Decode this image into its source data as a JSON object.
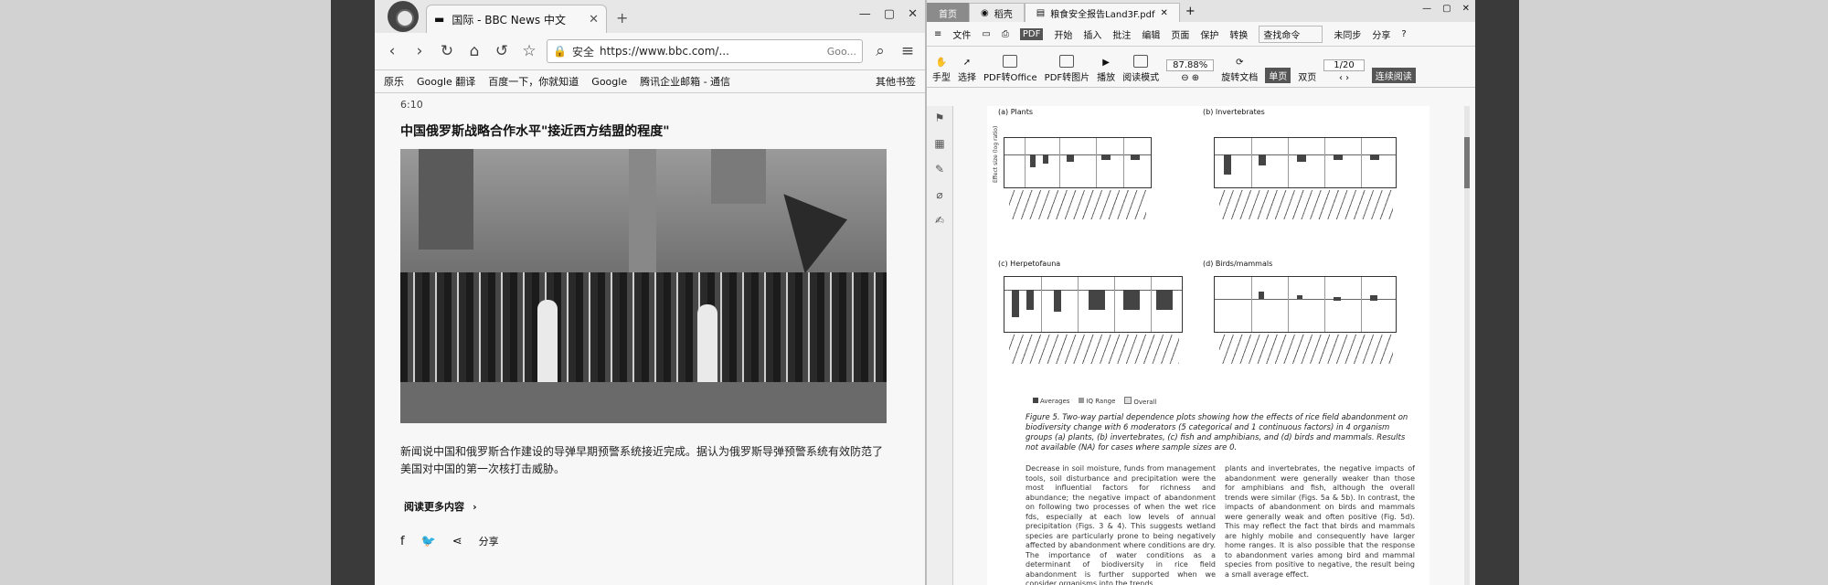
{
  "browser": {
    "tab_title": "国际 - BBC News 中文",
    "tab_icon": "bbc-icon",
    "window_controls": [
      "—",
      "▢",
      "✕"
    ],
    "address_secure": "安全",
    "address_url": "https://www.bbc.com/...",
    "address_search_placeholder": "Goo...",
    "bookmarks": [
      "原乐",
      "Google 翻译",
      "百度一下，你就知道",
      "Google",
      "腾讯企业邮箱 - 通信"
    ],
    "bookmarks_more": "其他书签"
  },
  "article": {
    "time": "6:10",
    "headline": "中国俄罗斯战略合作水平\"接近西方结盟的程度\"",
    "body": "新闻说中国和俄罗斯合作建设的导弹早期预警系统接近完成。据认为俄罗斯导弹预警系统有效防范了美国对中国的第一次核打击威胁。",
    "read_more": "阅读更多内容",
    "share_count": "分享"
  },
  "pdf_app": {
    "home_tab": "首页",
    "tab_1": "稻壳",
    "tab_2": "粮食安全报告Land3F.pdf",
    "window_controls": [
      "—",
      "▢",
      "✕"
    ],
    "menu": [
      "文件",
      "开始",
      "插入",
      "批注",
      "编辑",
      "页面",
      "保护",
      "转换"
    ],
    "menu_tag": "PDF",
    "find": "查找命令",
    "menu_right": [
      "未同步",
      "分享",
      "?"
    ],
    "ribbon": [
      "手型",
      "选择",
      "PDF转Office",
      "PDF转图片",
      "播放",
      "阅读模式",
      "旋转文档",
      "单页",
      "双页",
      "连续阅读"
    ],
    "zoom": "87.88%",
    "page": "1/20"
  },
  "pdf_page": {
    "fig_a": "(a) Plants",
    "fig_b": "(b) Invertebrates",
    "fig_c": "(c) Herpetofauna",
    "fig_d": "(d) Birds/mammals",
    "y_axis": "Effect size (log ratio)",
    "legend": [
      "Averages",
      "IQ Range",
      "Overall"
    ],
    "caption": "Figure 5. Two-way partial dependence plots showing how the effects of rice field abandonment on biodiversity change with 6 moderators (5 categorical and 1 continuous factors) in 4 organism groups (a) plants, (b) invertebrates, (c) fish and amphibians, and (d) birds and mammals. Results not available (NA) for cases where sample sizes are 0.",
    "col_left": "Decrease in soil moisture, funds from management tools, soil disturbance and precipitation were the most influential factors for richness and abundance; the negative impact of abandonment on following two processes of when the wet rice fds, especially at each low levels of annual precipitation (Figs. 3 & 4). This suggests wetland species are particularly prone to being negatively affected by abandonment where conditions are dry. The importance of water conditions as a determinant of biodiversity in rice field abandonment is further supported when we consider organisms into the trends.",
    "col_right": "plants and invertebrates, the negative impacts of abandonment were generally weaker than those for amphibians and fish, although the overall trends were similar (Figs. 5a & 5b). In contrast, the impacts of abandonment on birds and mammals were generally weak and often positive (Fig. 5d). This may reflect the fact that birds and mammals are highly mobile and consequently have larger home ranges. It is also possible that the response to abandonment varies among bird and mammal species from positive to negative, the result being a small average effect."
  }
}
